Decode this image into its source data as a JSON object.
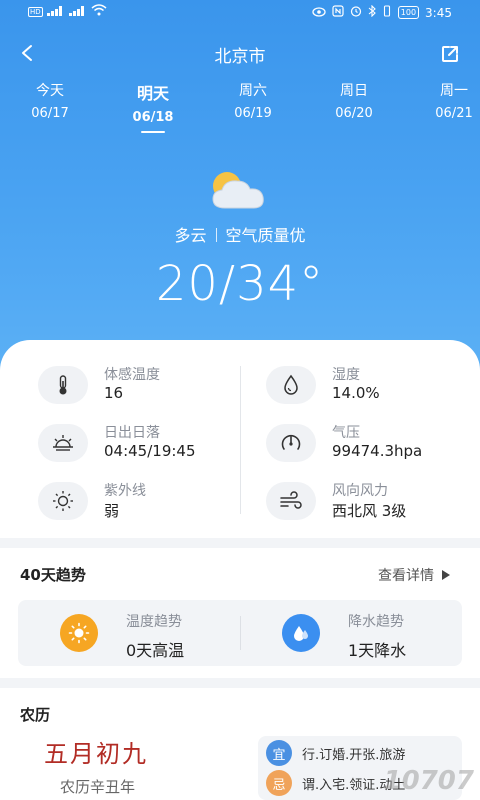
{
  "status_bar": {
    "time": "3:45",
    "battery": "100",
    "badge1": "HD",
    "badge2": "HD"
  },
  "nav": {
    "city": "北京市"
  },
  "days": [
    {
      "name": "今天",
      "date": "06/17",
      "active": false
    },
    {
      "name": "明天",
      "date": "06/18",
      "active": true
    },
    {
      "name": "周六",
      "date": "06/19",
      "active": false
    },
    {
      "name": "周日",
      "date": "06/20",
      "active": false
    },
    {
      "name": "周一",
      "date": "06/21",
      "active": false
    }
  ],
  "weather": {
    "condition": "多云",
    "air_quality": "空气质量优",
    "temperature": "20/34°"
  },
  "details": {
    "feels_like": {
      "label": "体感温度",
      "value": "16"
    },
    "humidity": {
      "label": "湿度",
      "value": "14.0%"
    },
    "sunrise": {
      "label": "日出日落",
      "value": "04:45/19:45"
    },
    "pressure": {
      "label": "气压",
      "value": "99474.3hpa"
    },
    "uv": {
      "label": "紫外线",
      "value": "弱"
    },
    "wind": {
      "label": "风向风力",
      "value": "西北风 3级"
    }
  },
  "trend": {
    "title": "40天趋势",
    "more": "查看详情",
    "temp_label": "温度趋势",
    "temp_value": "0天高温",
    "rain_label": "降水趋势",
    "rain_value": "1天降水"
  },
  "lunar": {
    "title": "农历",
    "date": "五月初九",
    "year": "农历辛丑年",
    "yi_badge": "宜",
    "yi_text": "行.订婚.开张.旅游",
    "ji_badge": "忌",
    "ji_text": "谓.入宅.领证.动土"
  },
  "watermark": "10707",
  "colors": {
    "hero_blue": "#3a95ec",
    "lunar_red": "#b22c25",
    "sun_orange": "#f6a623",
    "rain_blue": "#3b8ff0",
    "yi_blue": "#4a90e2",
    "ji_orange": "#f0a35a"
  }
}
